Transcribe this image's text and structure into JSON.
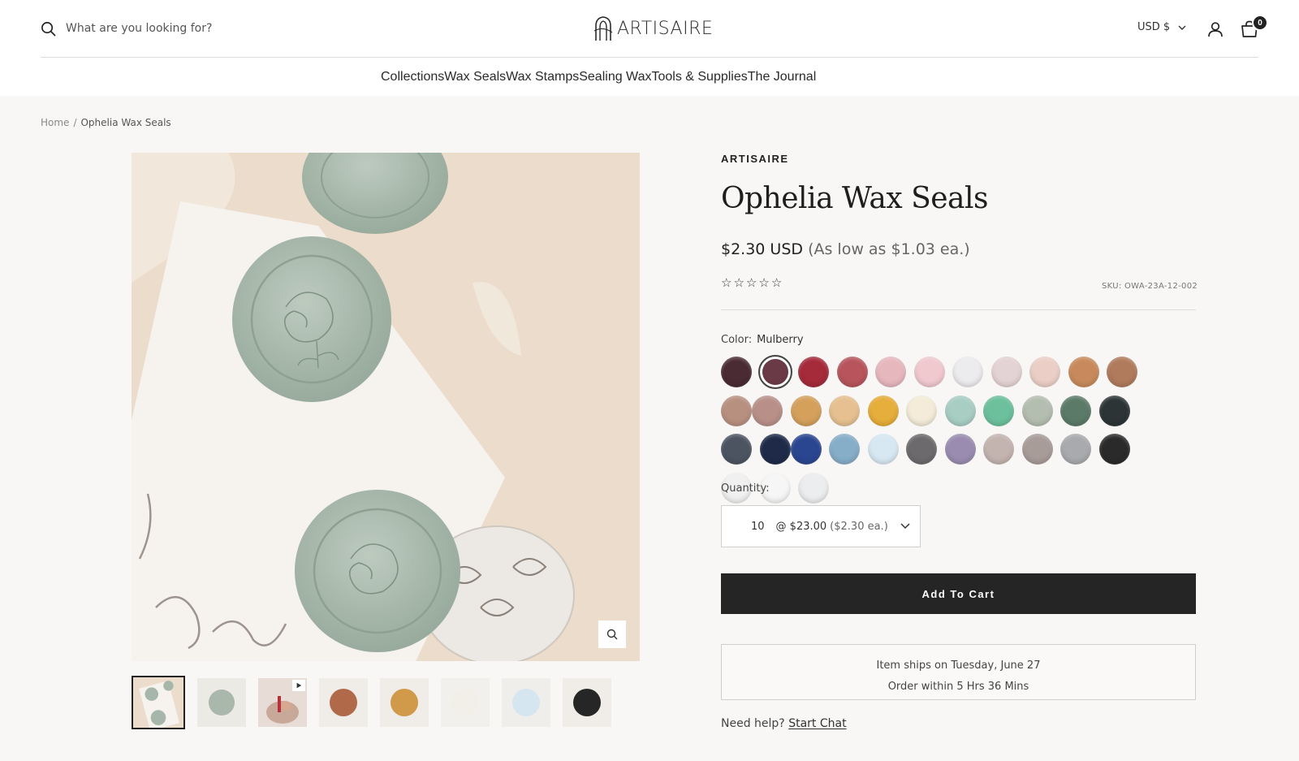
{
  "header": {
    "search_placeholder": "What are you looking for?",
    "logo_text": "ARTISAIRE",
    "currency": "USD $",
    "cart_count": "0"
  },
  "nav": {
    "items": [
      "Collections",
      "Wax Seals",
      "Wax Stamps",
      "Sealing Wax",
      "Tools & Supplies",
      "The Journal"
    ]
  },
  "breadcrumb": {
    "home": "Home",
    "separator": "/",
    "current": "Ophelia Wax Seals"
  },
  "product": {
    "brand": "ARTISAIRE",
    "title": "Ophelia Wax Seals",
    "price": "$2.30 USD",
    "price_note": "(As low as $1.03 ea.)",
    "rating_stars": 0,
    "sku": "SKU: OWA-23A-12-002",
    "color_label": "Color:",
    "color_value": "Mulberry",
    "swatch_colors": [
      "#4a2a33",
      "#6b3a47",
      "#a52a3a",
      "#b8545c",
      "#e6b8be",
      "#f0c9cf",
      "#ecebee",
      "#e4d3d4",
      "#ebcfc6",
      "#c88a5c",
      "#b07a5c",
      "#b89080",
      "#b89088",
      "#d4a05c",
      "#e6c090",
      "#e6ae3a",
      "#f4ecd8",
      "#a8cec4",
      "#6cc09c",
      "#b4beb0",
      "#5c7a68",
      "#2c3436",
      "#4c5462",
      "#1e2a48",
      "#2a4690",
      "#86aec8",
      "#d8e8f2",
      "#6c6a6c",
      "#9a8cb0",
      "#c4b4b0",
      "#a89c98",
      "#a8aaae",
      "#2a2a2a",
      "#f0f0f0",
      "#f6f6f6",
      "#ecedee"
    ],
    "selected_swatch": 1,
    "quantity_label": "Quantity:",
    "quantity": {
      "value": "10",
      "total": "@ $23.00",
      "each": "($2.30 ea.)"
    },
    "add_to_cart": "Add To Cart",
    "shipping_line1": "Item ships on Tuesday, June 27",
    "shipping_line2": "Order within 5 Hrs 36 Mins",
    "help_text": "Need help?",
    "help_link": "Start Chat"
  }
}
